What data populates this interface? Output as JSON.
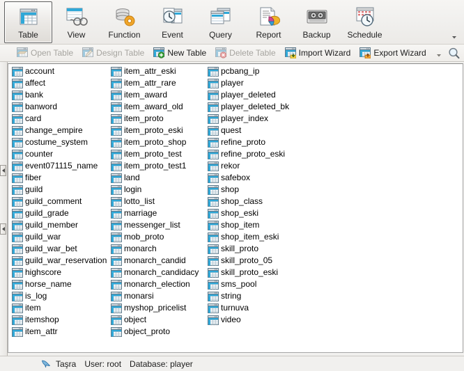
{
  "ribbon": {
    "buttons": [
      {
        "label": "Table",
        "icon": "table-icon",
        "active": true
      },
      {
        "label": "View",
        "icon": "view-icon",
        "active": false
      },
      {
        "label": "Function",
        "icon": "function-icon",
        "active": false
      },
      {
        "label": "Event",
        "icon": "event-icon",
        "active": false
      },
      {
        "label": "Query",
        "icon": "query-icon",
        "active": false
      },
      {
        "label": "Report",
        "icon": "report-icon",
        "active": false
      },
      {
        "label": "Backup",
        "icon": "backup-icon",
        "active": false
      },
      {
        "label": "Schedule",
        "icon": "schedule-icon",
        "active": false
      }
    ],
    "expand_icon": "chevron-down-icon"
  },
  "commandbar": {
    "commands": [
      {
        "label": "Open Table",
        "icon": "open-table-icon",
        "disabled": true
      },
      {
        "label": "Design Table",
        "icon": "design-table-icon",
        "disabled": true
      },
      {
        "label": "New Table",
        "icon": "new-table-icon",
        "disabled": false
      },
      {
        "label": "Delete Table",
        "icon": "delete-table-icon",
        "disabled": true
      },
      {
        "label": "Import Wizard",
        "icon": "import-wizard-icon",
        "disabled": false
      },
      {
        "label": "Export Wizard",
        "icon": "export-wizard-icon",
        "disabled": false
      }
    ],
    "expand_icon": "chevron-down-icon",
    "search_icon": "search-icon"
  },
  "object_list": {
    "columns": [
      [
        "account",
        "affect",
        "bank",
        "banword",
        "card",
        "change_empire",
        "costume_system",
        "counter",
        "event071115_name",
        "fiber",
        "guild",
        "guild_comment",
        "guild_grade",
        "guild_member",
        "guild_war",
        "guild_war_bet",
        "guild_war_reservation",
        "highscore",
        "horse_name",
        "is_log",
        "item",
        "itemshop",
        "item_attr"
      ],
      [
        "item_attr_eski",
        "item_attr_rare",
        "item_award",
        "item_award_old",
        "item_proto",
        "item_proto_eski",
        "item_proto_shop",
        "item_proto_test",
        "item_proto_test1",
        "land",
        "login",
        "lotto_list",
        "marriage",
        "messenger_list",
        "mob_proto",
        "monarch",
        "monarch_candid",
        "monarch_candidacy",
        "monarch_election",
        "monarsi",
        "myshop_pricelist",
        "object",
        "object_proto"
      ],
      [
        "pcbang_ip",
        "player",
        "player_deleted",
        "player_deleted_bk",
        "player_index",
        "quest",
        "refine_proto",
        "refine_proto_eski",
        "rekor",
        "safebox",
        "shop",
        "shop_class",
        "shop_eski",
        "shop_item",
        "shop_item_eski",
        "skill_proto",
        "skill_proto_05",
        "skill_proto_eski",
        "sms_pool",
        "string",
        "turnuva",
        "video"
      ]
    ],
    "item_icon": "table-icon"
  },
  "splitter": {
    "handle_icon": "collapse-left-arrow-icon"
  },
  "statusbar": {
    "connection_icon": "dolphin-icon",
    "connection": "Taşra",
    "user": "User: root",
    "database": "Database: player"
  },
  "colors": {
    "accent": "#2fa8d8",
    "chrome": "#f1f0ee",
    "list_bg": "#ffffff",
    "disabled_text": "#a6a49f"
  }
}
